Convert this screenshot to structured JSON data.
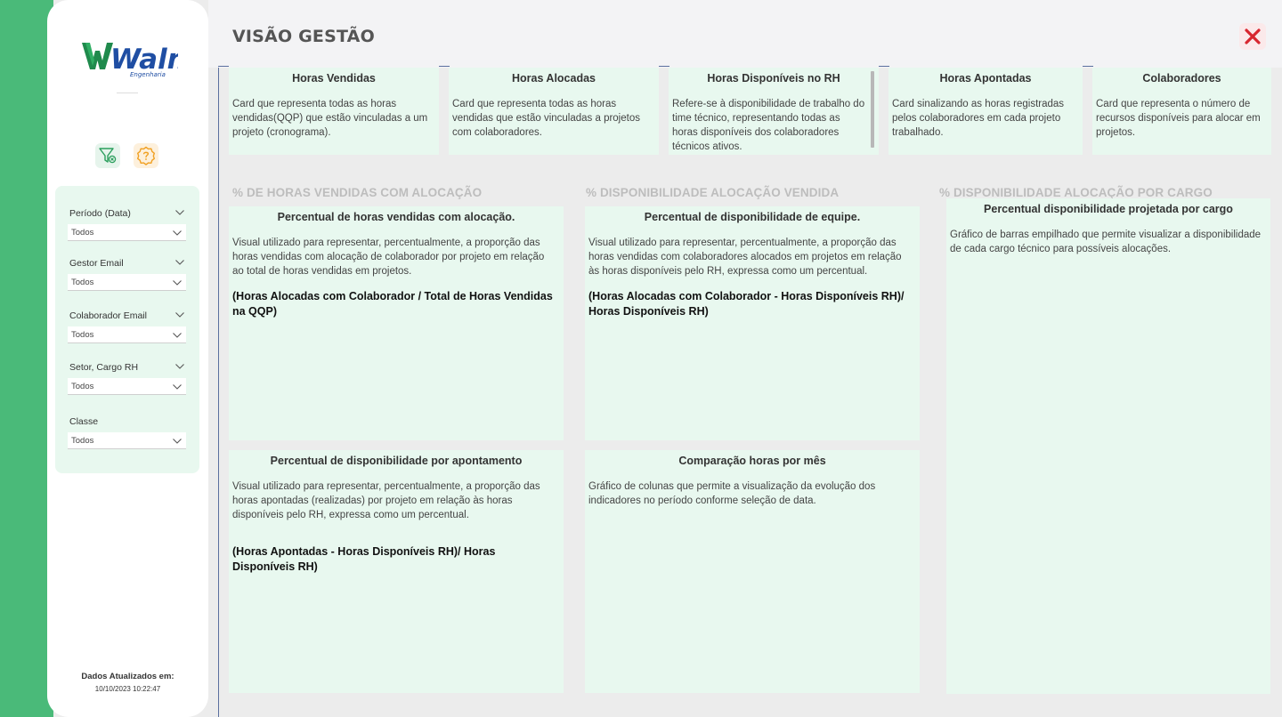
{
  "page": {
    "title": "VISÃO GESTÃO"
  },
  "brand": {
    "name": "Walm",
    "tagline": "Engenharia",
    "primary_color": "#1f8a4c",
    "secondary_color": "#1f4ea3",
    "accent_green": "#4aba79"
  },
  "sidebar": {
    "icons": [
      {
        "name": "clear-filter-icon"
      },
      {
        "name": "help-icon"
      }
    ],
    "filters": [
      {
        "label": "Período (Data)",
        "value": "Todos"
      },
      {
        "label": "Gestor Email",
        "value": "Todos"
      },
      {
        "label": "Colaborador Email",
        "value": "Todos"
      },
      {
        "label": "Setor, Cargo RH",
        "value": "Todos"
      },
      {
        "label": "Classe",
        "value": "Todos"
      }
    ],
    "updated_label": "Dados Atualizados em:",
    "updated_value": "10/10/2023 10:22:47"
  },
  "kpi_cards": [
    {
      "title": "Horas Vendidas",
      "description": "Card que representa todas as horas vendidas(QQP) que estão vinculadas a um projeto (cronograma)."
    },
    {
      "title": "Horas Alocadas",
      "description": "Card que representa todas as horas vendidas que estão vinculadas a projetos com colaboradores."
    },
    {
      "title": "Horas Disponíveis no RH",
      "description": "Refere-se à disponibilidade de trabalho do time técnico, representando todas as horas disponíveis dos colaboradores técnicos ativos."
    },
    {
      "title": "Horas Apontadas",
      "description": "Card sinalizando as horas registradas pelos colaboradores em cada projeto trabalhado."
    },
    {
      "title": "Colaboradores",
      "description": "Card que representa o número de recursos  disponíveis para alocar em projetos."
    }
  ],
  "sections": [
    {
      "title": "% DE HORAS VENDIDAS COM ALOCAÇÃO"
    },
    {
      "title": "% DISPONIBILIDADE ALOCAÇÃO VENDIDA"
    },
    {
      "title": "% DISPONIBILIDADE ALOCAÇÃO POR CARGO"
    }
  ],
  "panels": [
    {
      "title": "Percentual de horas vendidas com alocação.",
      "description": "Visual utilizado para representar, percentualmente, a proporção das horas vendidas com alocação de colaborador por projeto em relação ao total de horas vendidas em projetos.",
      "formula": "(Horas Alocadas com Colaborador / Total de Horas Vendidas na QQP)"
    },
    {
      "title": "Percentual de disponibilidade de equipe.",
      "description": "Visual utilizado para representar, percentualmente, a proporção das horas vendidas com colaboradores alocados em projetos em relação às horas disponíveis pelo RH, expressa como um percentual.",
      "formula": "(Horas Alocadas com Colaborador  - Horas Disponíveis RH)/ Horas Disponíveis RH)"
    },
    {
      "title": "Percentual disponibilidade projetada por cargo",
      "description": "Gráfico de barras empilhado que permite visualizar a disponibilidade de cada cargo técnico para possíveis alocações."
    },
    {
      "title": "Percentual de disponibilidade por apontamento",
      "description": "Visual utilizado para representar, percentualmente, a proporção das horas apontadas (realizadas) por projeto em relação às horas disponíveis pelo RH, expressa como um percentual.",
      "formula": "(Horas Apontadas  - Horas Disponíveis RH)/ Horas Disponíveis RH)"
    },
    {
      "title": "Comparação horas por mês",
      "description": "Gráfico de colunas que permite a visualização da evolução dos indicadores no período conforme seleção de data."
    }
  ]
}
